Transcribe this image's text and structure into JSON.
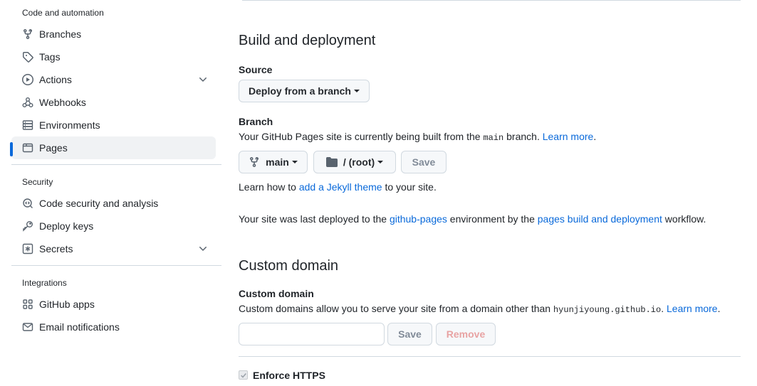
{
  "sidebar": {
    "sections": [
      {
        "heading": "Code and automation",
        "items": [
          {
            "label": "Branches",
            "icon": "branch-icon"
          },
          {
            "label": "Tags",
            "icon": "tag-icon"
          },
          {
            "label": "Actions",
            "icon": "play-icon",
            "expandable": true
          },
          {
            "label": "Webhooks",
            "icon": "webhook-icon"
          },
          {
            "label": "Environments",
            "icon": "server-icon"
          },
          {
            "label": "Pages",
            "icon": "browser-icon",
            "active": true
          }
        ]
      },
      {
        "heading": "Security",
        "items": [
          {
            "label": "Code security and analysis",
            "icon": "codescan-icon"
          },
          {
            "label": "Deploy keys",
            "icon": "key-icon"
          },
          {
            "label": "Secrets",
            "icon": "asterisk-icon",
            "expandable": true
          }
        ]
      },
      {
        "heading": "Integrations",
        "items": [
          {
            "label": "GitHub apps",
            "icon": "apps-icon"
          },
          {
            "label": "Email notifications",
            "icon": "mail-icon"
          }
        ]
      }
    ]
  },
  "build": {
    "title": "Build and deployment",
    "source_label": "Source",
    "source_button": "Deploy from a branch",
    "branch_label": "Branch",
    "branch_desc_pre": "Your GitHub Pages site is currently being built from the ",
    "branch_desc_code": "main",
    "branch_desc_post": " branch. ",
    "branch_learn_more": "Learn more",
    "branch_desc_end": ".",
    "branch_select": "main",
    "folder_select": "/ (root)",
    "save": "Save",
    "jekyll_pre": "Learn how to ",
    "jekyll_link": "add a Jekyll theme",
    "jekyll_post": " to your site.",
    "deployed_pre": "Your site was last deployed to the ",
    "deployed_env_link": "github-pages",
    "deployed_mid": " environment by the ",
    "deployed_workflow_link": "pages build and deployment",
    "deployed_post": " workflow."
  },
  "custom_domain": {
    "title": "Custom domain",
    "label": "Custom domain",
    "desc_pre": "Custom domains allow you to serve your site from a domain other than ",
    "desc_code": "hyunjiyoung.github.io",
    "desc_post": ". ",
    "learn_more": "Learn more",
    "desc_end": ".",
    "input_value": "",
    "save": "Save",
    "remove": "Remove"
  },
  "https": {
    "label": "Enforce HTTPS",
    "checked": true
  },
  "colors": {
    "accent": "#0969da",
    "text": "#1f2328",
    "muted": "#59636e",
    "border": "#d1d9e0",
    "danger_disabled": "#e8a3a3"
  }
}
